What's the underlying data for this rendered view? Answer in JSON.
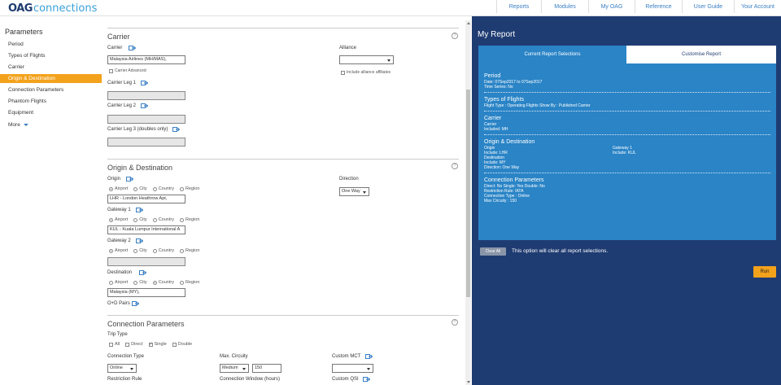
{
  "logo": {
    "brand": "OAG",
    "product": "connections"
  },
  "nav": [
    "Reports",
    "Modules",
    "My OAG",
    "Reference",
    "User Guide",
    "Your Account"
  ],
  "sidebar": {
    "title": "Parameters",
    "items": [
      "Period",
      "Types of Flights",
      "Carrier",
      "Origin & Destination",
      "Connection Parameters",
      "Phantom Flights",
      "Equipment",
      "More"
    ]
  },
  "carrier": {
    "title": "Carrier",
    "carrier_label": "Carrier",
    "carrier_value": "Malaysia Airlines (MH/MAS),",
    "carrier_advanced": "Carrier Advanced",
    "leg1_label": "Carrier Leg 1",
    "leg2_label": "Carrier Leg 2",
    "leg3_label": "Carrier Leg 3 (doubles only)",
    "alliance_label": "Alliance",
    "alliance_value": "",
    "include_affiliates": "Include alliance affiliates"
  },
  "od": {
    "title": "Origin & Destination",
    "origin_label": "Origin",
    "origin_value": "LHR - London Heathrow Apt,",
    "gateway1_label": "Gateway 1",
    "gateway1_value": "KUL - Kuala Lumpur International A",
    "gateway2_label": "Gateway 2",
    "destination_label": "Destination",
    "destination_value": "Malaysia (MY),",
    "od_pairs": "O+D Pairs",
    "direction_label": "Direction",
    "direction_value": "One Way",
    "radio_options": [
      "Airport",
      "City",
      "Country",
      "Region"
    ]
  },
  "conn": {
    "title": "Connection Parameters",
    "trip_type_label": "Trip Type",
    "trip_options": [
      "All",
      "Direct",
      "Single",
      "Double"
    ],
    "connection_type_label": "Connection Type",
    "connection_type_value": "Online",
    "max_circuity_label": "Max. Circuity",
    "max_circuity_value": "Medium",
    "max_circuity_number": "150",
    "custom_mct_label": "Custom MCT",
    "custom_mct_value": "",
    "restriction_rule_label": "Restriction Rule",
    "connection_window_label": "Connection Window (hours)",
    "custom_qsi_label": "Custom QSI"
  },
  "panel": {
    "title": "My Report",
    "tab_current": "Current Report Selections",
    "tab_customise": "Customise Report",
    "period_h": "Period",
    "period_lines": [
      "Date: 07Sep2017  to 07Sep2017",
      "Time Series: No"
    ],
    "types_h": "Types of Flights",
    "types_lines": [
      "Flight Type : Operating Flights   Show By : Published Carrier"
    ],
    "carrier_h": "Carrier",
    "carrier_lines": [
      "Carrier",
      "Included: MH"
    ],
    "od_h": "Origin & Destination",
    "od_left": [
      "Origin",
      "Include: LHR",
      "Destination",
      "Include: MY",
      "Direction: One Way"
    ],
    "od_right": [
      "Gateway 1",
      "Include: KUL"
    ],
    "conn_h": "Connection Parameters",
    "conn_lines": [
      "Direct: No    Single: Yes    Double: No",
      "Restriction Rule: IATA",
      "Connection Type : Online",
      "Max Circuity : 150"
    ],
    "clear_label": "Clear All",
    "clear_msg": "This option will clear all report selections.",
    "run_label": "Run"
  },
  "colors": {
    "accent_orange": "#f3a21c",
    "panel_navy": "#1f3c72",
    "panel_blue": "#2a84c6",
    "link_blue": "#3a7fc4"
  }
}
